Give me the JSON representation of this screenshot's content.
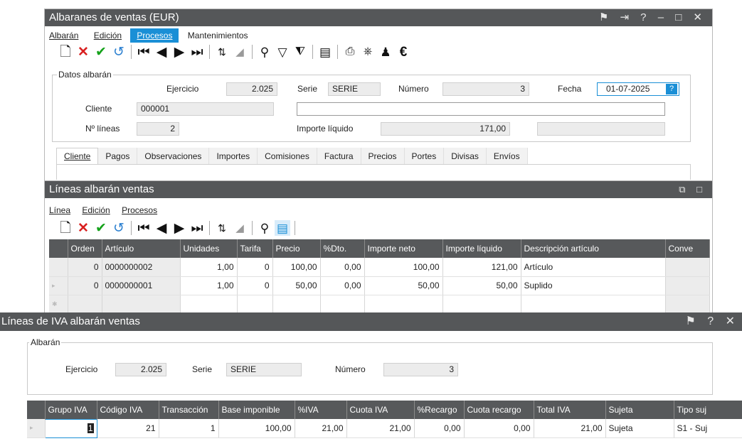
{
  "albaranes": {
    "title": "Albaranes de ventas (EUR)",
    "title_controls": "⚑ ⇥ ? – □ ✕",
    "menu": [
      "Albarán",
      "Edición",
      "Procesos",
      "Mantenimientos"
    ],
    "active_menu": "Procesos",
    "group_title": "Datos albarán",
    "ejercicio_label": "Ejercicio",
    "ejercicio_value": "2.025",
    "serie_label": "Serie",
    "serie_value": "SERIE",
    "numero_label": "Número",
    "numero_value": "3",
    "fecha_label": "Fecha",
    "fecha_value": "01-07-2025",
    "fecha_help": "?",
    "cliente_label": "Cliente",
    "cliente_value": "000001",
    "cliente_nombre": "",
    "nlineas_label": "Nº líneas",
    "nlineas_value": "2",
    "importe_label": "Importe líquido",
    "importe_value": "171,00",
    "importe_extra": "",
    "tabs": [
      "Cliente",
      "Pagos",
      "Observaciones",
      "Importes",
      "Comisiones",
      "Factura",
      "Precios",
      "Portes",
      "Divisas",
      "Envíos"
    ]
  },
  "lineas": {
    "title": "Líneas albarán ventas",
    "title_controls": "⧉ □",
    "menu": [
      "Línea",
      "Edición",
      "Procesos"
    ],
    "columns": [
      "Orden",
      "Artículo",
      "Unidades",
      "Tarifa",
      "Precio",
      "%Dto.",
      "Importe neto",
      "Importe líquido",
      "Descripción artículo",
      "Conve"
    ],
    "rows": [
      [
        "0",
        "0000000002",
        "1,00",
        "0",
        "100,00",
        "0,00",
        "100,00",
        "121,00",
        "Artículo",
        ""
      ],
      [
        "0",
        "0000000001",
        "1,00",
        "0",
        "50,00",
        "0,00",
        "50,00",
        "50,00",
        "Suplido",
        ""
      ]
    ]
  },
  "iva": {
    "title": "Líneas de IVA albarán ventas",
    "title_controls": "⚑ ? ✕",
    "group_title": "Albarán",
    "ejercicio_label": "Ejercicio",
    "ejercicio_value": "2.025",
    "serie_label": "Serie",
    "serie_value": "SERIE",
    "numero_label": "Número",
    "numero_value": "3",
    "columns": [
      "Grupo IVA",
      "Código IVA",
      "Transacción",
      "Base imponible",
      "%IVA",
      "Cuota IVA",
      "%Recargo",
      "Cuota recargo",
      "Total IVA",
      "Sujeta",
      "Tipo suj"
    ],
    "rows": [
      [
        "1",
        "21",
        "1",
        "100,00",
        "21,00",
        "21,00",
        "0,00",
        "0,00",
        "21,00",
        "Sujeta",
        "S1 - Suj"
      ]
    ]
  },
  "toolbar_icons": [
    "new-icon",
    "delete-icon",
    "accept-icon",
    "undo-icon",
    "first-icon",
    "prev-icon",
    "next-icon",
    "last-icon",
    "sort-icon",
    "filter-clear-icon",
    "search-icon",
    "filter-icon",
    "filter-remove-icon",
    "grid-icon",
    "print-icon",
    "print-setup-icon",
    "user-icon",
    "euro-icon"
  ],
  "colors": {
    "titlebar": "#555759",
    "accent": "#1a8fd6",
    "delete": "#d92020",
    "accept": "#15a21b"
  }
}
